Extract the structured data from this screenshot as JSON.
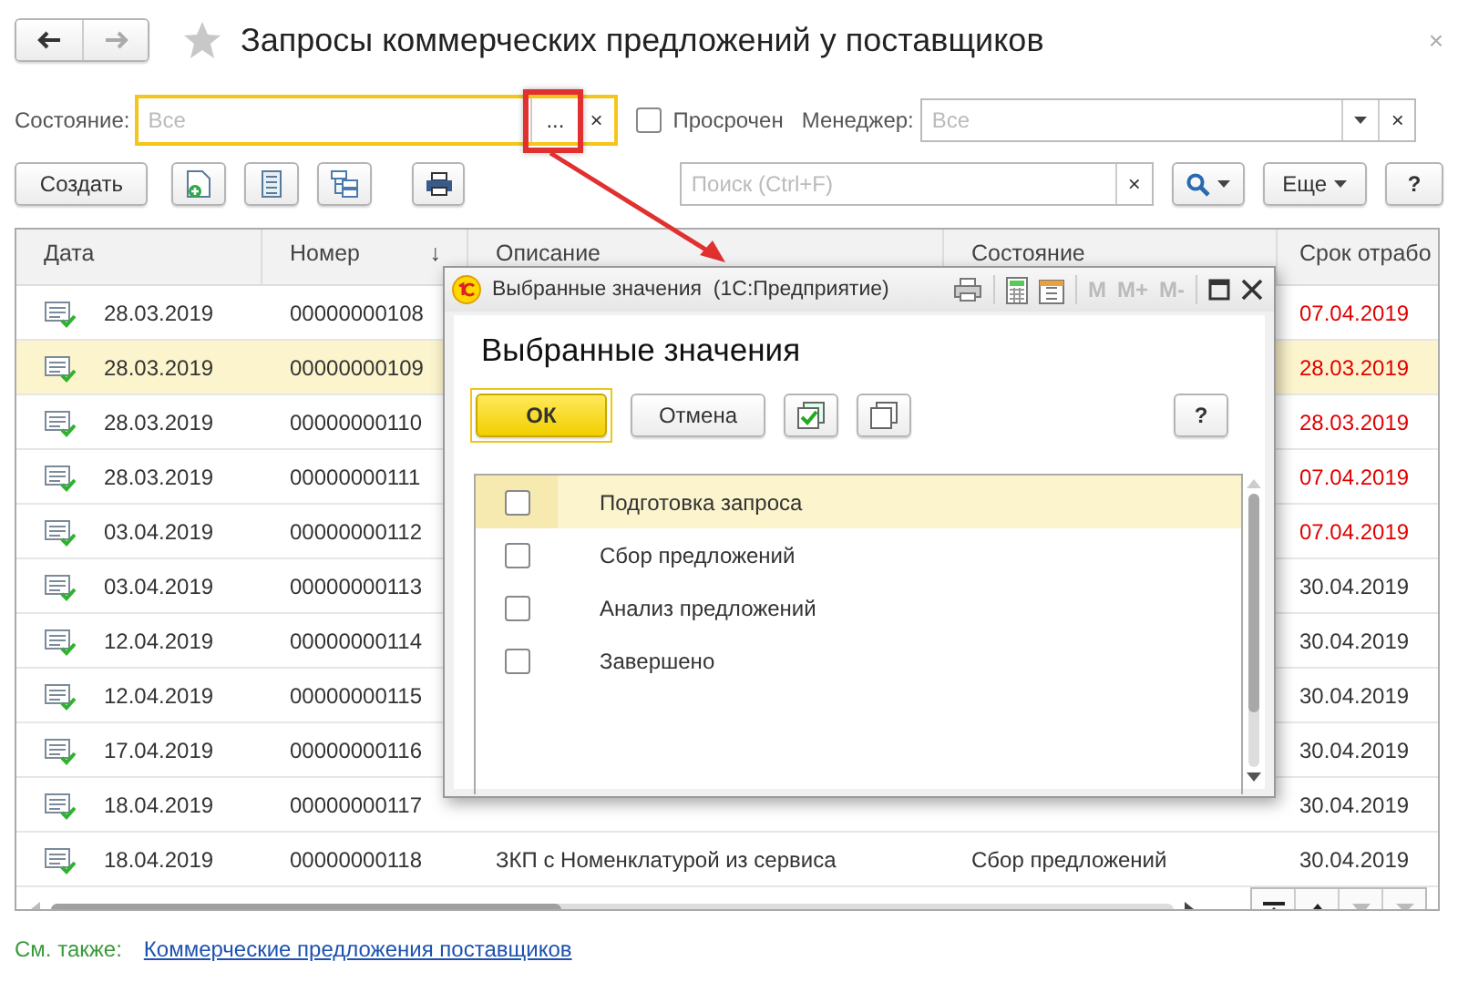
{
  "window": {
    "title": "Запросы коммерческих предложений у поставщиков",
    "close": "×"
  },
  "filters": {
    "state": {
      "label": "Состояние:",
      "placeholder": "Все",
      "select": "...",
      "clear": "×"
    },
    "overdue": {
      "label": "Просрочен",
      "checked": false
    },
    "manager": {
      "label": "Менеджер:",
      "placeholder": "Все",
      "clear": "×"
    }
  },
  "toolbar": {
    "create": "Создать",
    "search": {
      "placeholder": "Поиск (Ctrl+F)",
      "clear": "×"
    },
    "more": "Еще",
    "help": "?"
  },
  "table": {
    "columns": [
      {
        "label": "Дата"
      },
      {
        "label": "Номер",
        "sort_mark": "↓"
      },
      {
        "label": "Описание"
      },
      {
        "label": "Состояние"
      },
      {
        "label": "Срок отрабо"
      }
    ],
    "rows": [
      {
        "date": "28.03.2019",
        "number": "00000000108",
        "deadline": "07.04.2019",
        "overdue": true,
        "selected": false
      },
      {
        "date": "28.03.2019",
        "number": "00000000109",
        "deadline": "28.03.2019",
        "overdue": true,
        "selected": true
      },
      {
        "date": "28.03.2019",
        "number": "00000000110",
        "deadline": "28.03.2019",
        "overdue": true,
        "selected": false
      },
      {
        "date": "28.03.2019",
        "number": "00000000111",
        "deadline": "07.04.2019",
        "overdue": true,
        "selected": false
      },
      {
        "date": "03.04.2019",
        "number": "00000000112",
        "deadline": "07.04.2019",
        "overdue": true,
        "selected": false
      },
      {
        "date": "03.04.2019",
        "number": "00000000113",
        "deadline": "30.04.2019",
        "overdue": false,
        "selected": false
      },
      {
        "date": "12.04.2019",
        "number": "00000000114",
        "deadline": "30.04.2019",
        "overdue": false,
        "selected": false
      },
      {
        "date": "12.04.2019",
        "number": "00000000115",
        "deadline": "30.04.2019",
        "overdue": false,
        "selected": false
      },
      {
        "date": "17.04.2019",
        "number": "00000000116",
        "deadline": "30.04.2019",
        "overdue": false,
        "selected": false
      },
      {
        "date": "18.04.2019",
        "number": "00000000117",
        "deadline": "30.04.2019",
        "overdue": false,
        "selected": false
      },
      {
        "date": "18.04.2019",
        "number": "00000000118",
        "description": "ЗКП с Номенклатурой из сервиса",
        "state": "Сбор предложений",
        "deadline": "30.04.2019",
        "overdue": false,
        "selected": false
      }
    ]
  },
  "see_also": {
    "label": "См. также:",
    "link": "Коммерческие предложения поставщиков"
  },
  "dialog": {
    "title": "Выбранные значения  (1С:Предприятие)",
    "memory_buttons": [
      {
        "label": "M",
        "disabled": true
      },
      {
        "label": "M+",
        "disabled": true
      },
      {
        "label": "M-",
        "disabled": true
      }
    ],
    "heading": "Выбранные значения",
    "ok": "ОК",
    "cancel": "Отмена",
    "help": "?",
    "items": [
      {
        "label": "Подготовка запроса",
        "checked": false,
        "selected": true
      },
      {
        "label": "Сбор предложений",
        "checked": false,
        "selected": false
      },
      {
        "label": "Анализ предложений",
        "checked": false,
        "selected": false
      },
      {
        "label": "Завершено",
        "checked": false,
        "selected": false
      }
    ]
  }
}
